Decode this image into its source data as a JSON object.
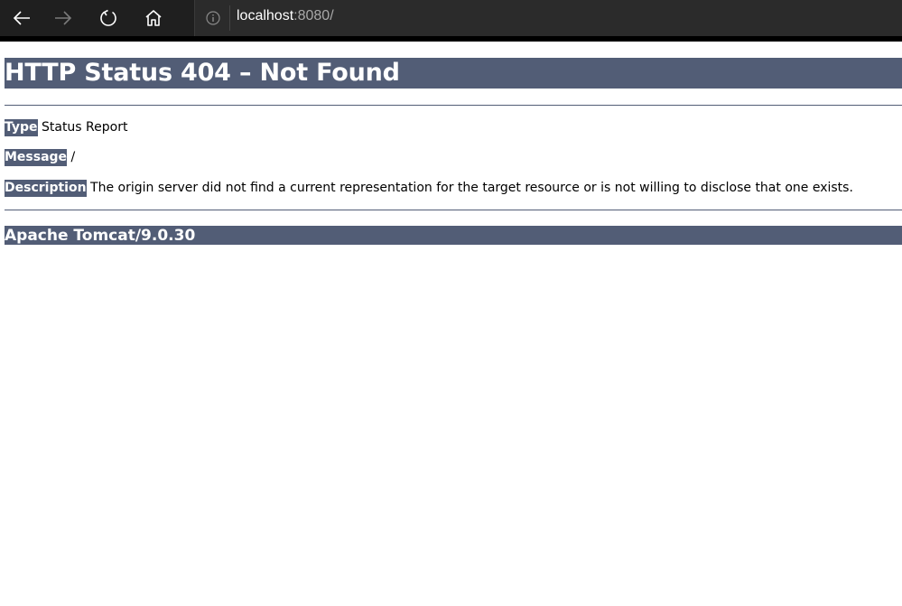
{
  "browser": {
    "url_host": "localhost",
    "url_rest": ":8080/",
    "icons": [
      "back-arrow-icon",
      "forward-arrow-icon",
      "refresh-icon",
      "home-icon",
      "info-icon"
    ]
  },
  "page": {
    "title": "HTTP Status 404 – Not Found",
    "type_label": "Type",
    "type_value": "Status Report",
    "message_label": "Message",
    "message_value": "/",
    "description_label": "Description",
    "description_value": "The origin server did not find a current representation for the target resource or is not willing to disclose that one exists.",
    "footer": "Apache Tomcat/9.0.30"
  },
  "colors": {
    "tomcat_band": "#525d76",
    "browser_bar": "#1f1f1f",
    "address_bar": "#2b2b2b"
  }
}
